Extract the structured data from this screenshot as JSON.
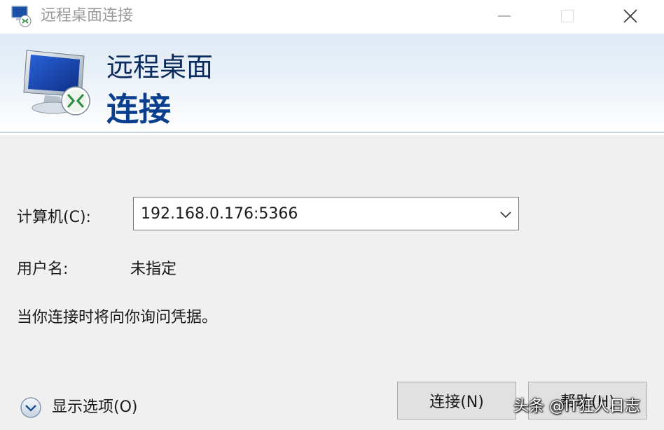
{
  "window": {
    "title": "远程桌面连接",
    "icons": {
      "app": "remote-desktop-icon",
      "minimize": "minimize-icon",
      "maximize": "maximize-icon",
      "close": "close-icon"
    }
  },
  "banner": {
    "line1": "远程桌面",
    "line2": "连接",
    "icon": "monitor-remote-icon"
  },
  "form": {
    "computer_label": "计算机(C):",
    "computer_value": "192.168.0.176:5366",
    "username_label": "用户名:",
    "username_value": "未指定",
    "credentials_note": "当你连接时将向你询问凭据。"
  },
  "footer": {
    "show_options_label": "显示选项(O)",
    "connect_button": "连接(N)",
    "help_button": "帮助(H)"
  },
  "watermark": "头条 @IT狂人日志",
  "colors": {
    "banner_title": "#0b2a5e",
    "banner_subtitle": "#0a3f8f",
    "button_bg": "#e1e1e1",
    "window_bg": "#f0f0f0"
  }
}
